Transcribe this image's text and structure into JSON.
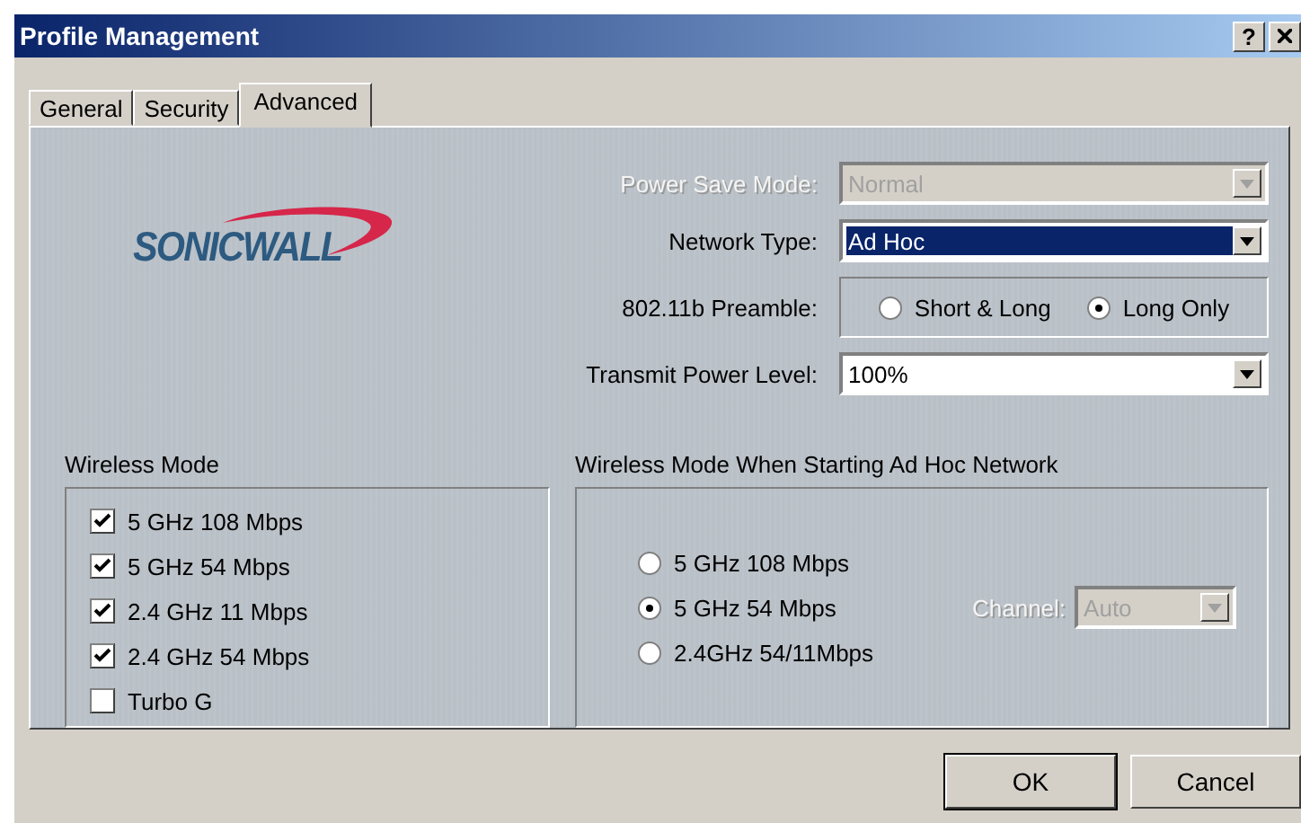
{
  "window": {
    "title": "Profile Management",
    "help": "?"
  },
  "tabs": [
    {
      "label": "General",
      "selected": false
    },
    {
      "label": "Security",
      "selected": false
    },
    {
      "label": "Advanced",
      "selected": true
    }
  ],
  "logo": {
    "text": "SONICWALL"
  },
  "settings": [
    {
      "kind": "dropdown",
      "label": "Power Save Mode:",
      "value": "Normal",
      "disabled": true,
      "highlighted": false
    },
    {
      "kind": "dropdown",
      "label": "Network Type:",
      "value": "Ad Hoc",
      "disabled": false,
      "highlighted": true
    },
    {
      "kind": "radios",
      "label": "802.11b Preamble:",
      "options": [
        {
          "label": "Short & Long",
          "selected": false
        },
        {
          "label": "Long Only",
          "selected": true
        }
      ]
    },
    {
      "kind": "dropdown",
      "label": "Transmit Power Level:",
      "value": "100%",
      "disabled": false,
      "highlighted": false
    }
  ],
  "wireless_mode": {
    "title": "Wireless Mode",
    "options": [
      {
        "label": "5 GHz 108 Mbps",
        "checked": true
      },
      {
        "label": "5 GHz 54 Mbps",
        "checked": true
      },
      {
        "label": "2.4 GHz 11 Mbps",
        "checked": true
      },
      {
        "label": "2.4 GHz 54 Mbps",
        "checked": true
      },
      {
        "label": "Turbo G",
        "checked": false
      }
    ]
  },
  "adhoc_mode": {
    "title": "Wireless Mode When Starting Ad Hoc Network",
    "options": [
      {
        "label": "5 GHz 108 Mbps",
        "selected": false
      },
      {
        "label": "5 GHz 54 Mbps",
        "selected": true
      },
      {
        "label": "2.4GHz 54/11Mbps",
        "selected": false
      }
    ],
    "channel": {
      "label": "Channel:",
      "value": "Auto",
      "disabled": true
    }
  },
  "buttons": [
    {
      "label": "OK",
      "default": true
    },
    {
      "label": "Cancel",
      "default": false
    }
  ]
}
